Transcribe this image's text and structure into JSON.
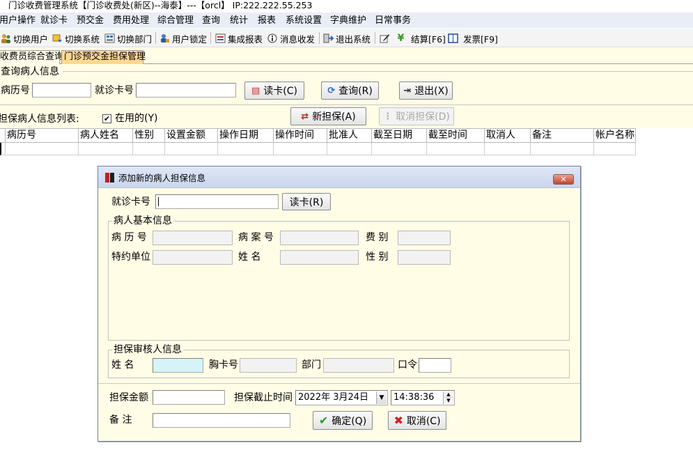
{
  "window": {
    "title": "门诊收费管理系统【门诊收费处(新区)--海泰】---【orcl】 IP:222.222.55.253"
  },
  "menu": [
    "用户操作",
    "就诊卡",
    "预交金",
    "费用处理",
    "综合管理",
    "查询",
    "统计",
    "报表",
    "系统设置",
    "字典维护",
    "日常事务"
  ],
  "toolbar": {
    "switch_user": "切换用户",
    "switch_system": "切换系统",
    "switch_dept": "切换部门",
    "user_lock": "用户锁定",
    "integrated_report": "集成报表",
    "messages": "消息收发",
    "exit_system": "退出系统",
    "settle": "结算[F6]",
    "invoice": "发票[F9]"
  },
  "tabs": {
    "tab1": "收费员综合查询",
    "tab2": "门诊预交金担保管理"
  },
  "query": {
    "group_title": "查询病人信息",
    "record_no_label": "病历号",
    "card_no_label": "就诊卡号",
    "read_card": "读卡(C)",
    "query": "查询(R)",
    "exit": "退出(X)"
  },
  "list": {
    "title": "担保病人信息列表:",
    "in_use_label": "在用的(Y)",
    "in_use_checked": true,
    "new_guarantee": "新担保(A)",
    "cancel_guarantee": "取消担保(D)"
  },
  "grid": {
    "columns": [
      "病历号",
      "病人姓名",
      "性别",
      "设置金额",
      "操作日期",
      "操作时间",
      "批准人",
      "截至日期",
      "截至时间",
      "取消人",
      "备注",
      "帐户名称"
    ]
  },
  "dialog": {
    "title": "添加新的病人担保信息",
    "close": "✕",
    "card_no_label": "就诊卡号",
    "read_card": "读卡(R)",
    "patient_group": "病人基本信息",
    "record_no_label": "病 历 号",
    "case_no_label": "病 案 号",
    "fee_type_label": "费  别",
    "contract_unit_label": "特约单位",
    "name_label": "姓    名",
    "gender_label": "性  别",
    "reviewer_group": "担保审核人信息",
    "reviewer_name_label": "姓    名",
    "badge_no_label": "胸卡号",
    "dept_label": "部门",
    "password_label": "口令",
    "amount_label": "担保金额",
    "deadline_label": "担保截止时间",
    "deadline_date": "2022年 3月24日",
    "deadline_time": "14:38:36",
    "remark_label": "备    注",
    "ok": "确定(Q)",
    "cancel": "取消(C)"
  },
  "colors": {
    "panel_bg": "#fffde6",
    "active_tab": "#ffd890",
    "menu_bg": "#e8edf6",
    "highlight_input": "#d6f4f7"
  }
}
